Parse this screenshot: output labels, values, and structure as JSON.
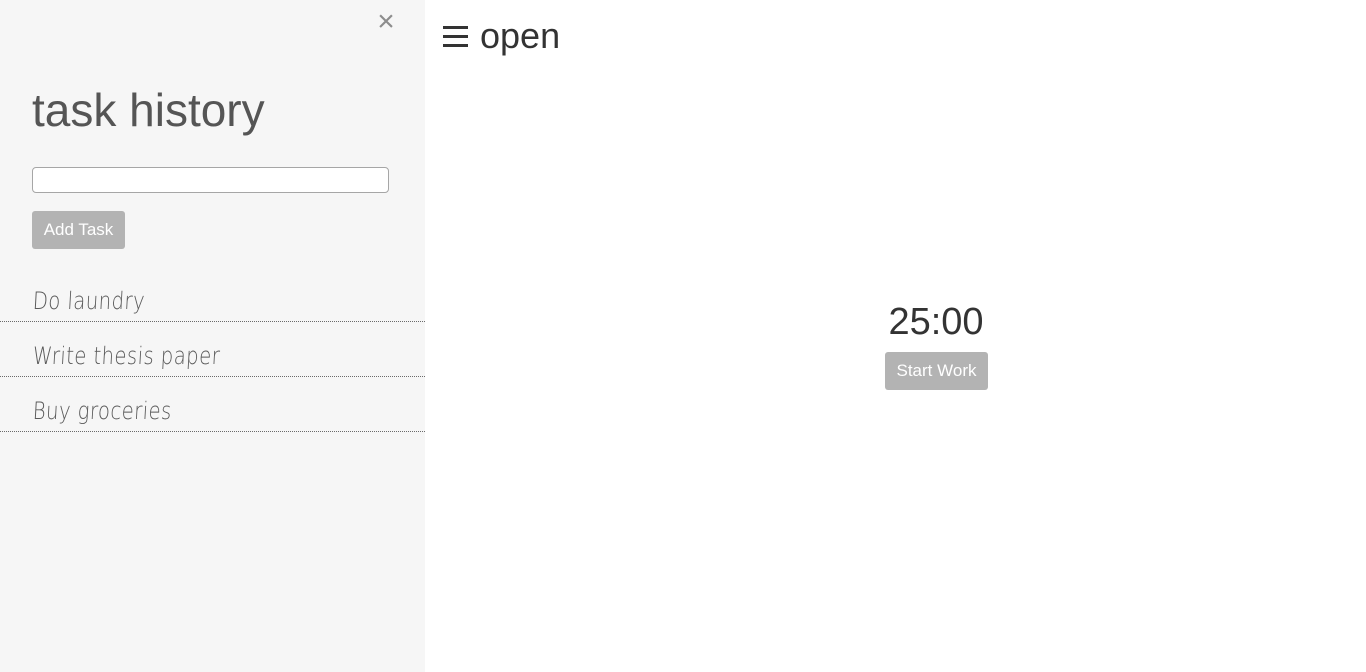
{
  "sidebar": {
    "close_icon": "close-icon",
    "close_glyph": "×",
    "title": "task history",
    "task_input": {
      "value": "",
      "placeholder": ""
    },
    "add_task_label": "Add Task",
    "tasks": [
      {
        "text": "Do laundry"
      },
      {
        "text": "Write thesis paper"
      },
      {
        "text": "Buy groceries"
      }
    ]
  },
  "header": {
    "menu_icon": "hamburger-icon",
    "open_label": "open"
  },
  "timer": {
    "display": "25:00",
    "start_label": "Start Work"
  },
  "colors": {
    "sidebar_bg": "#f6f6f6",
    "button_bg": "#b3b3b3",
    "text_dark": "#333333"
  }
}
